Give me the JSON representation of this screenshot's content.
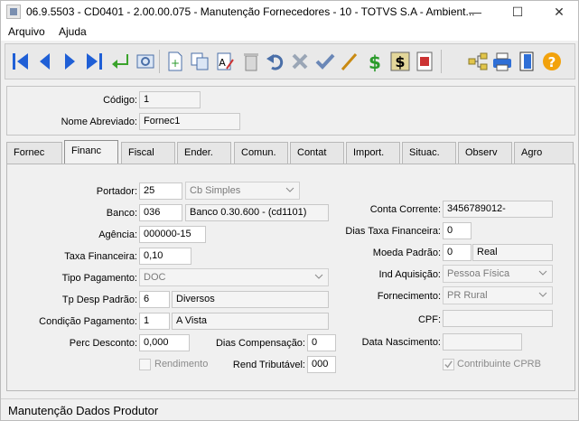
{
  "window": {
    "title": "06.9.5503 - CD0401 - 2.00.00.075 - Manutenção Fornecedores - 10 - TOTVS S.A - Ambient..."
  },
  "menu": {
    "items": [
      "Arquivo",
      "Ajuda"
    ]
  },
  "toolbar": {
    "buttons": [
      "first-icon",
      "previous-icon",
      "next-icon",
      "last-icon",
      "goto-icon",
      "search-icon",
      "new-icon",
      "copy-icon",
      "edit-icon",
      "delete-icon",
      "undo-icon",
      "cancel-icon",
      "save-icon",
      "query-icon",
      "currency-icon",
      "finance-icon",
      "report-icon",
      "hierarchy-icon",
      "print-icon",
      "exit-icon",
      "help-icon"
    ]
  },
  "header": {
    "codigo_label": "Código:",
    "codigo_value": "1",
    "nome_label": "Nome Abreviado:",
    "nome_value": "Fornec1"
  },
  "tabs": [
    "Fornec",
    "Financ",
    "Fiscal",
    "Ender.",
    "Comun.",
    "Contat",
    "Import.",
    "Situac.",
    "Observ",
    "Agro"
  ],
  "active_tab": "Financ",
  "form": {
    "portador": {
      "label": "Portador:",
      "value": "25",
      "desc": "Cb Simples"
    },
    "banco": {
      "label": "Banco:",
      "value": "036",
      "desc": "Banco 0.30.600 - (cd1101)"
    },
    "agencia": {
      "label": "Agência:",
      "value": "000000-15"
    },
    "taxa_fin": {
      "label": "Taxa Financeira:",
      "value": "0,10"
    },
    "tipo_pag": {
      "label": "Tipo Pagamento:",
      "value": "DOC"
    },
    "tp_desp": {
      "label": "Tp Desp Padrão:",
      "value": "6",
      "desc": "Diversos"
    },
    "cond_pag": {
      "label": "Condição Pagamento:",
      "value": "1",
      "desc": "A Vista"
    },
    "perc_desc": {
      "label": "Perc Desconto:",
      "value": "0,000"
    },
    "dias_comp": {
      "label": "Dias Compensação:",
      "value": "0"
    },
    "rendimento": {
      "label": "Rendimento",
      "checked": false
    },
    "rend_trib": {
      "label": "Rend Tributável:",
      "value": "000"
    },
    "conta_corrente": {
      "label": "Conta Corrente:",
      "value": "3456789012-"
    },
    "dias_taxa": {
      "label": "Dias Taxa Financeira:",
      "value": "0"
    },
    "moeda": {
      "label": "Moeda Padrão:",
      "value": "0",
      "desc": "Real"
    },
    "ind_aquis": {
      "label": "Ind Aquisição:",
      "value": "Pessoa Física"
    },
    "fornecimento": {
      "label": "Fornecimento:",
      "value": "PR Rural"
    },
    "cpf": {
      "label": "CPF:",
      "value": ""
    },
    "data_nasc": {
      "label": "Data Nascimento:",
      "value": ""
    },
    "contribuinte": {
      "label": "Contribuinte CPRB",
      "checked": true
    }
  },
  "status": {
    "text": "Manutenção Dados Produtor"
  }
}
